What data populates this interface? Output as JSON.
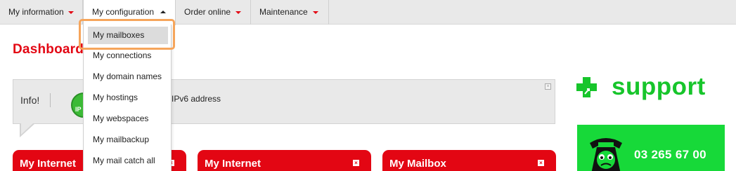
{
  "nav": {
    "items": [
      {
        "label": "My information"
      },
      {
        "label": "My configuration"
      },
      {
        "label": "Order online"
      },
      {
        "label": "Maintenance"
      }
    ]
  },
  "dropdown": {
    "items": [
      {
        "label": "My mailboxes"
      },
      {
        "label": "My connections"
      },
      {
        "label": "My domain names"
      },
      {
        "label": "My hostings"
      },
      {
        "label": "My webspaces"
      },
      {
        "label": "My mailbackup"
      },
      {
        "label": "My mail catch all"
      }
    ]
  },
  "dashboard": {
    "title": "Dashboard"
  },
  "info": {
    "label": "Info!",
    "badge": "IP",
    "message": "IPv6 address",
    "close": "×"
  },
  "support": {
    "label": "support",
    "phone": "03 265 67 00"
  },
  "widgets": [
    {
      "title": "My Internet",
      "close": "×"
    },
    {
      "title": "My Internet",
      "close": "×"
    },
    {
      "title": "My Mailbox",
      "close": "×"
    }
  ],
  "colors": {
    "accent": "#e30613",
    "support_green": "#17c52b",
    "phone_panel": "#17d939",
    "highlight": "#f6a55b"
  }
}
